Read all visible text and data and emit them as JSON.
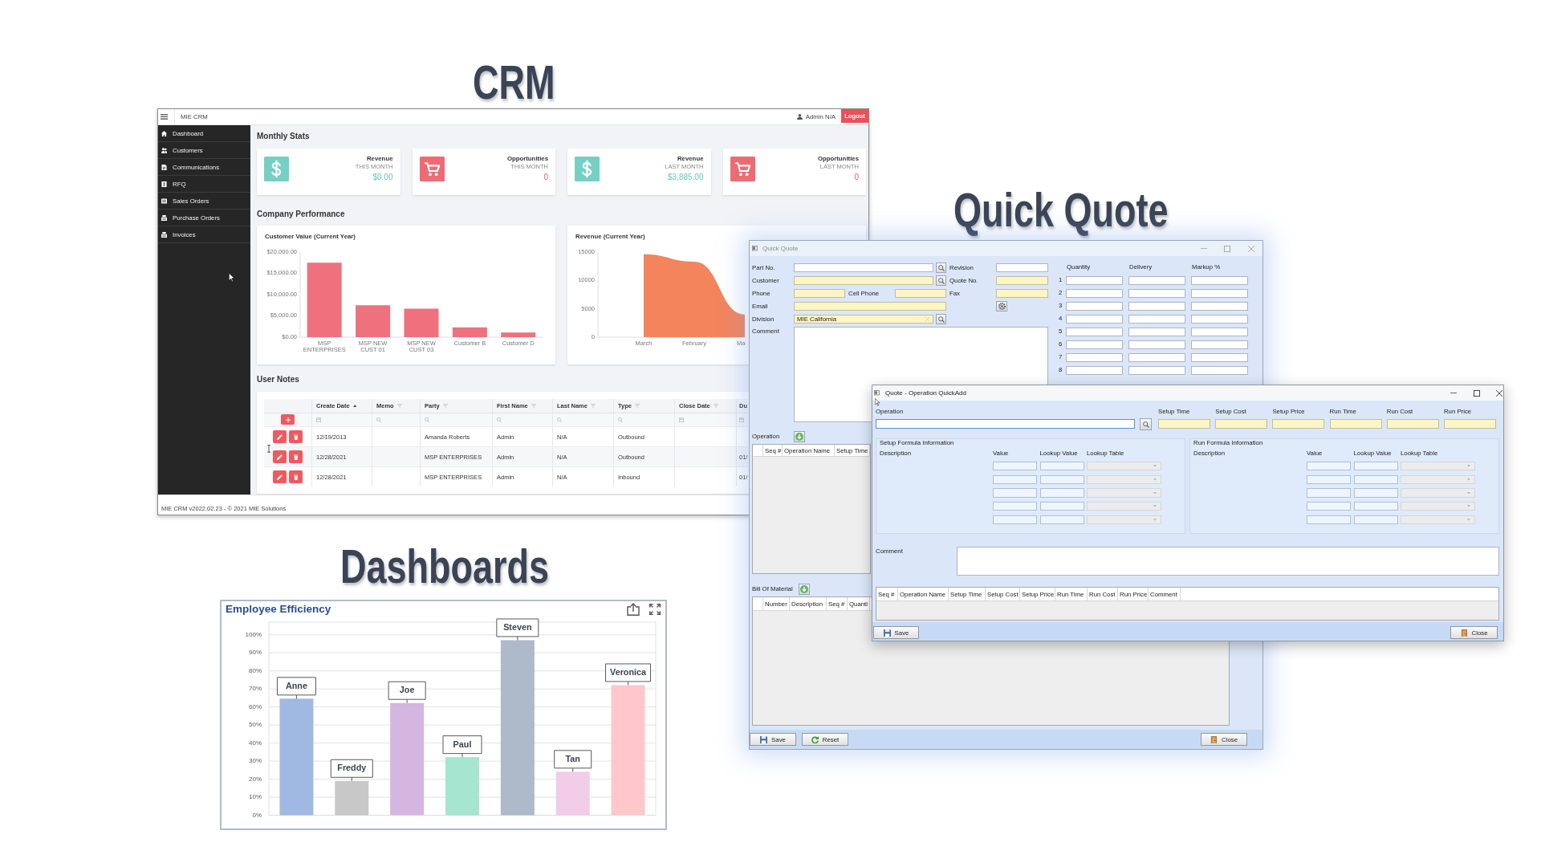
{
  "captions": [
    "CRM",
    "Quick Quote",
    "Dashboards"
  ],
  "crm": {
    "app_name": "MIE CRM",
    "user": "Admin N/A",
    "logout": "Logout",
    "sidebar": [
      "Dashboard",
      "Customers",
      "Communications",
      "RFQ",
      "Sales Orders",
      "Purchase Orders",
      "Invoices"
    ],
    "stats_title": "Monthly Stats",
    "stats": [
      {
        "kind": "revenue",
        "title": "Revenue",
        "period": "THIS MONTH",
        "value": "$0.00"
      },
      {
        "kind": "opportunities",
        "title": "Opportunities",
        "period": "THIS MONTH",
        "value": "0"
      },
      {
        "kind": "revenue",
        "title": "Revenue",
        "period": "LAST MONTH",
        "value": "$3,885.00"
      },
      {
        "kind": "opportunities",
        "title": "Opportunities",
        "period": "LAST MONTH",
        "value": "0"
      }
    ],
    "performance_title": "Company Performance",
    "customer_value": {
      "chart_data": {
        "type": "bar",
        "title": "Customer Value (Current Year)",
        "categories": [
          "MSP ENTERPRISES",
          "MSP NEW CUST 01",
          "MSP NEW CUST 03",
          "Customer B",
          "Customer D"
        ],
        "values": [
          17500,
          7500,
          6700,
          2300,
          1100
        ],
        "ylim": [
          0,
          20000
        ],
        "yticks": [
          {
            "value": 0,
            "label": "$0.00"
          },
          {
            "value": 5000,
            "label": "$5,000.00"
          },
          {
            "value": 10000,
            "label": "$10,000.00"
          },
          {
            "value": 15000,
            "label": "$15,000.00"
          },
          {
            "value": 20000,
            "label": "$20,000.00"
          }
        ]
      }
    },
    "revenue": {
      "chart_data": {
        "type": "area",
        "title": "Revenue (Current Year)",
        "categories": [
          "March",
          "February",
          "Ma"
        ],
        "values": [
          14600,
          13300,
          4000
        ],
        "ylim": [
          0,
          15000
        ],
        "yticks": [
          0,
          5000,
          10000,
          15000
        ]
      }
    },
    "notes_title": "User Notes",
    "notes": {
      "columns": [
        {
          "label": "Create Date",
          "sorted": true,
          "header_filter": false,
          "kind": "date"
        },
        {
          "label": "Memo",
          "sorted": false,
          "header_filter": true,
          "kind": "text"
        },
        {
          "label": "Party",
          "sorted": false,
          "header_filter": true,
          "kind": "text"
        },
        {
          "label": "First Name",
          "sorted": false,
          "header_filter": true,
          "kind": "text"
        },
        {
          "label": "Last Name",
          "sorted": false,
          "header_filter": true,
          "kind": "text"
        },
        {
          "label": "Type",
          "sorted": false,
          "header_filter": true,
          "kind": "text"
        },
        {
          "label": "Close Date",
          "sorted": false,
          "header_filter": true,
          "kind": "date"
        },
        {
          "label": "Du",
          "kind": "date"
        }
      ],
      "rows": [
        {
          "create_date": "12/19/2013",
          "party": "Amanda Roberts",
          "first_name": "Admin",
          "last_name": "N/A",
          "type": "Outbound"
        },
        {
          "create_date": "12/28/2021",
          "party": "MSP ENTERPRISES",
          "first_name": "Admin",
          "last_name": "N/A",
          "type": "Outbound",
          "column_9": "01/"
        },
        {
          "create_date": "12/28/2021",
          "party": "MSP ENTERPRISES",
          "first_name": "Admin",
          "last_name": "N/A",
          "type": "Inbound",
          "column_9": "01/"
        }
      ]
    },
    "footer": "MIE CRM v2022.02.23 - © 2021 MIE Solutions"
  },
  "quick_quote": {
    "title": "Quick Quote",
    "active": false,
    "part_no": {
      "label": "Part No.",
      "required": false
    },
    "revision": {
      "label": "Revision",
      "required": false
    },
    "customer": {
      "label": "Customer",
      "required": true
    },
    "quote_no": {
      "label": "Quote No.",
      "required": true
    },
    "phone": {
      "label": "Phone",
      "required": true
    },
    "cell_phone": {
      "label": "Cell Phone",
      "required": true
    },
    "fax": {
      "label": "Fax",
      "required": true
    },
    "email": {
      "label": "Email",
      "required": true
    },
    "division": {
      "label": "Division",
      "required": true,
      "value": "MIE California"
    },
    "comment": {
      "label": "Comment"
    },
    "breaks": {
      "columns": [
        "Quantity",
        "Delivery",
        "Markup %"
      ],
      "rows": [
        "1",
        "2",
        "3",
        "4",
        "5",
        "6",
        "7",
        "8"
      ]
    },
    "operation": {
      "label": "Operation",
      "columns": [
        "Seq #",
        "Operation Name",
        "Setup Time"
      ]
    },
    "bill_of_material": {
      "label": "Bill Of Material",
      "columns": [
        "Number",
        "Description",
        "Seq #",
        "Quanti"
      ]
    },
    "buttons": [
      "Save",
      "Reset",
      "Close"
    ]
  },
  "quick_add": {
    "title": "Quote - Operation QuickAdd",
    "active": true,
    "operation_label": "Operation",
    "cost_fields": [
      {
        "label": "Setup Time",
        "required": true
      },
      {
        "label": "Setup Cost",
        "required": true
      },
      {
        "label": "Setup Price",
        "required": true
      },
      {
        "label": "Run Time",
        "required": true
      },
      {
        "label": "Run Cost",
        "required": true
      },
      {
        "label": "Run Price",
        "required": true
      }
    ],
    "formula_groups": [
      {
        "title": "Setup Formula Information",
        "headers": [
          "Description",
          "Value",
          "Lookup Value",
          "Lookup Table"
        ]
      },
      {
        "title": "Run Formula Information",
        "headers": [
          "Description",
          "Value",
          "Lookup Value",
          "Lookup Table"
        ]
      }
    ],
    "comment_label": "Comment",
    "grid_columns": [
      "Seq #",
      "Operation Name",
      "Setup Time",
      "Setup Cost",
      "Setup Price",
      "Run Time",
      "Run Cost",
      "Run Price",
      "Comment"
    ],
    "buttons": [
      "Save",
      "Close"
    ]
  },
  "dashboard": {
    "chart_data": {
      "type": "bar",
      "title": "Employee Efficiency",
      "categories": [
        "Anne",
        "Freddy",
        "Joe",
        "Paul",
        "Steven",
        "Tan",
        "Veronica"
      ],
      "values": [
        64.6,
        19,
        62.2,
        32.2,
        97,
        24.1,
        72.1
      ],
      "colors": [
        "#9fb9e3",
        "#c8c8c8",
        "#d5b6e0",
        "#a6e5cf",
        "#aebaca",
        "#f2cde7",
        "#fec8cb"
      ],
      "ylim": [
        0,
        107
      ],
      "grid": true,
      "yticks": [
        {
          "value": 0,
          "label": "0%"
        },
        {
          "value": 10,
          "label": "10%"
        },
        {
          "value": 20,
          "label": "20%"
        },
        {
          "value": 30,
          "label": "30%"
        },
        {
          "value": 40,
          "label": "40%"
        },
        {
          "value": 50,
          "label": "50%"
        },
        {
          "value": 60,
          "label": "60%"
        },
        {
          "value": 70,
          "label": "70%"
        },
        {
          "value": 80,
          "label": "80%"
        },
        {
          "value": 90,
          "label": "90%"
        },
        {
          "value": 100,
          "label": "100%"
        }
      ]
    }
  }
}
